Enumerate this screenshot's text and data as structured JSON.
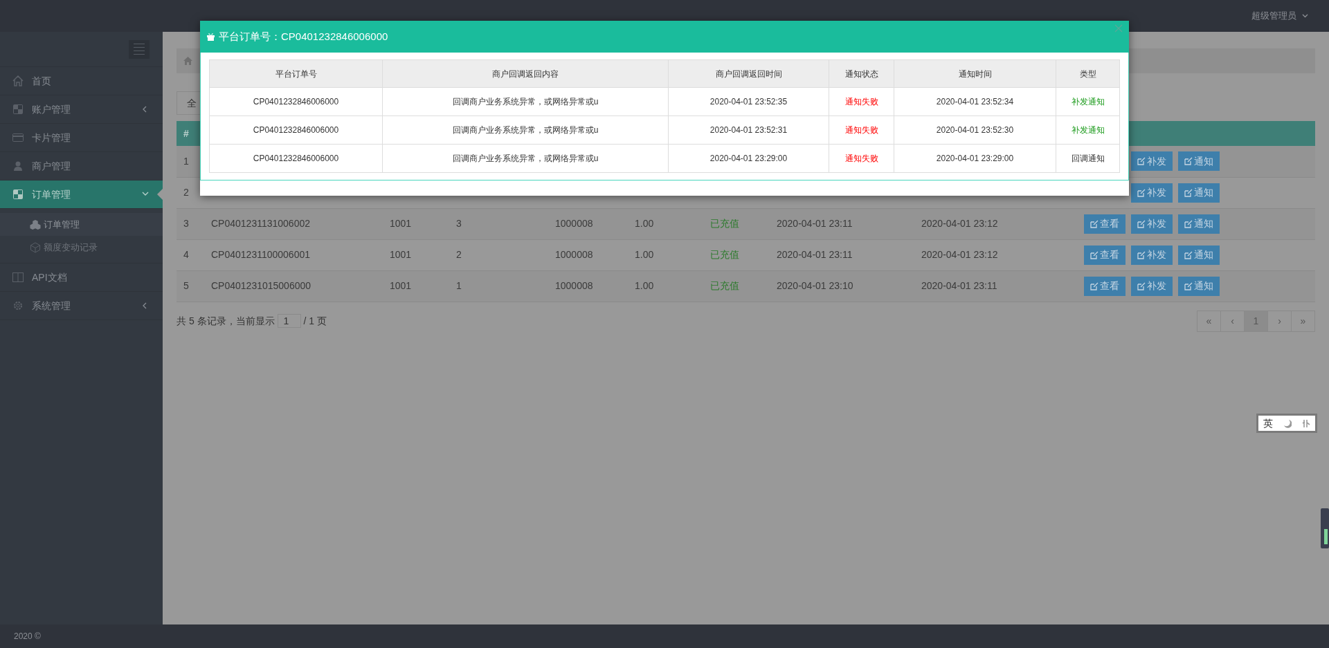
{
  "topbar": {
    "user": "超级管理员"
  },
  "sidebar": {
    "items": [
      {
        "label": "首页",
        "expandable": false,
        "selected": false
      },
      {
        "label": "账户管理",
        "expandable": true,
        "expanded": false,
        "selected": false
      },
      {
        "label": "卡片管理",
        "expandable": false,
        "selected": false
      },
      {
        "label": "商户管理",
        "expandable": false,
        "selected": false
      },
      {
        "label": "订单管理",
        "expandable": true,
        "expanded": true,
        "selected": true,
        "children": [
          {
            "label": "订单管理",
            "selected": true
          },
          {
            "label": "额度变动记录",
            "selected": false
          }
        ]
      },
      {
        "label": "API文档",
        "expandable": false,
        "selected": false
      },
      {
        "label": "系统管理",
        "expandable": true,
        "expanded": false,
        "selected": false
      }
    ]
  },
  "toolbar": {
    "button": "全"
  },
  "orders": {
    "columns": [
      "#"
    ],
    "rows": [
      {
        "index": "1",
        "actions": [
          "补发",
          "通知"
        ]
      },
      {
        "index": "2",
        "actions": [
          "补发",
          "通知"
        ]
      },
      {
        "index": "3",
        "order_no": "CP0401231131006002",
        "merchant": "1001",
        "count": "3",
        "card": "1000008",
        "amount": "1.00",
        "status": "已充值",
        "created": "2020-04-01 23:11",
        "finished": "2020-04-01 23:12",
        "actions": [
          "查看",
          "补发",
          "通知"
        ]
      },
      {
        "index": "4",
        "order_no": "CP0401231100006001",
        "merchant": "1001",
        "count": "2",
        "card": "1000008",
        "amount": "1.00",
        "status": "已充值",
        "created": "2020-04-01 23:11",
        "finished": "2020-04-01 23:12",
        "actions": [
          "查看",
          "补发",
          "通知"
        ]
      },
      {
        "index": "5",
        "order_no": "CP0401231015006000",
        "merchant": "1001",
        "count": "1",
        "card": "1000008",
        "amount": "1.00",
        "status": "已充值",
        "created": "2020-04-01 23:10",
        "finished": "2020-04-01 23:11",
        "actions": [
          "查看",
          "补发",
          "通知"
        ]
      }
    ]
  },
  "pager": {
    "summary": "共 5 条记录，当前显示",
    "page": "1",
    "total": "/ 1 页",
    "buttons": [
      {
        "label": "«",
        "selected": false
      },
      {
        "label": "‹",
        "selected": false
      },
      {
        "label": "1",
        "selected": true
      },
      {
        "label": "›",
        "selected": false
      },
      {
        "label": "»",
        "selected": false
      }
    ]
  },
  "footer": "2020 ©",
  "ime": {
    "mode": "英"
  },
  "modal": {
    "title": "平台订单号：CP0401232846006000",
    "columns": [
      "平台订单号",
      "商户回调返回内容",
      "商户回调返回时间",
      "通知状态",
      "通知时间",
      "类型"
    ],
    "rows": [
      {
        "order_no": "CP0401232846006000",
        "content": "回调商户业务系统异常，或网络异常或u",
        "reply_time": "2020-04-01 23:52:35",
        "status": {
          "text": "通知失败",
          "failed": true
        },
        "notify_time": "2020-04-01 23:52:34",
        "type": {
          "text": "补发通知",
          "resend": true
        }
      },
      {
        "order_no": "CP0401232846006000",
        "content": "回调商户业务系统异常，或网络异常或u",
        "reply_time": "2020-04-01 23:52:31",
        "status": {
          "text": "通知失败",
          "failed": true
        },
        "notify_time": "2020-04-01 23:52:30",
        "type": {
          "text": "补发通知",
          "resend": true
        }
      },
      {
        "order_no": "CP0401232846006000",
        "content": "回调商户业务系统异常，或网络异常或u",
        "reply_time": "2020-04-01 23:29:00",
        "status": {
          "text": "通知失败",
          "failed": true
        },
        "notify_time": "2020-04-01 23:29:00",
        "type": {
          "text": "回调通知",
          "resend": false
        }
      }
    ]
  }
}
